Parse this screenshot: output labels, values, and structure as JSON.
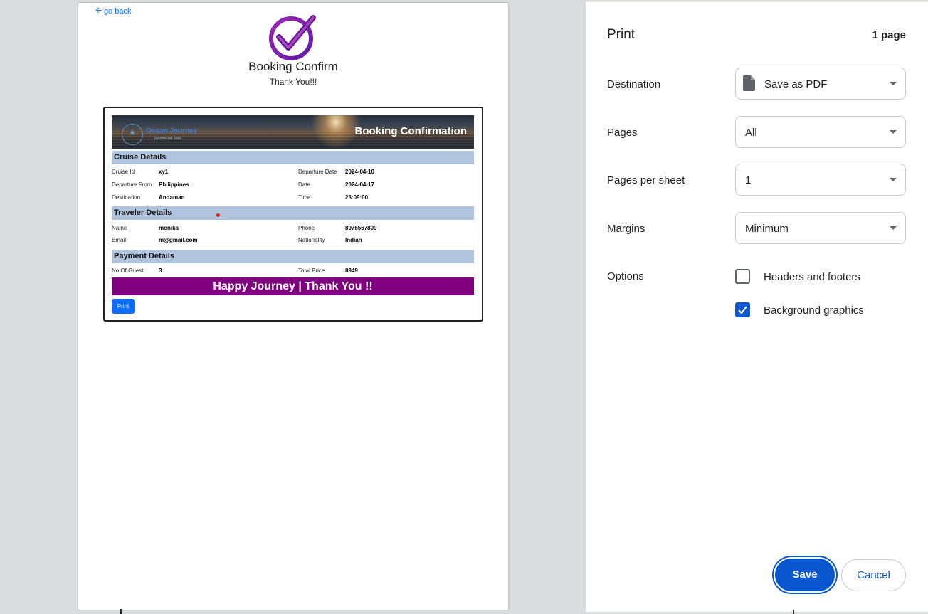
{
  "preview": {
    "go_back": "go back",
    "confirm_title": "Booking Confirm",
    "confirm_subtitle": "Thank You!!!",
    "ticket": {
      "banner_title": "Booking Confirmation",
      "brand_name": "Ocean Journey",
      "brand_tagline": "Explore the Seas",
      "sections": {
        "cruise": "Cruise Details",
        "traveler": "Traveler Details",
        "payment": "Payment Details"
      },
      "cruise_details": [
        {
          "label": "Cruise Id",
          "value": "xy1",
          "label2": "Departure Date",
          "value2": "2024-04-10"
        },
        {
          "label": "Departure From",
          "value": "Philippines",
          "label2": "Date",
          "value2": "2024-04-17"
        },
        {
          "label": "Destination",
          "value": "Andaman",
          "label2": "Time",
          "value2": "23:09:00"
        }
      ],
      "traveler_details": [
        {
          "label": "Name",
          "value": "monika",
          "label2": "Phone",
          "value2": "8976567809"
        },
        {
          "label": "Email",
          "value": "m@gmail.com",
          "label2": "Nationality",
          "value2": "Indian"
        }
      ],
      "payment_details": [
        {
          "label": "No Of Guest",
          "value": "3",
          "label2": "Total Price",
          "value2": "8949"
        }
      ],
      "footer": "Happy Journey | Thank You !!",
      "print_button": "Print"
    },
    "colors": {
      "section_bg": "#b0c4de",
      "footer_bg": "#800080",
      "logo_purple": "#7b1fa2"
    }
  },
  "panel": {
    "title": "Print",
    "page_count": "1 page",
    "destination": {
      "label": "Destination",
      "value": "Save as PDF",
      "icon": "document-icon"
    },
    "pages": {
      "label": "Pages",
      "value": "All"
    },
    "pages_per_sheet": {
      "label": "Pages per sheet",
      "value": "1"
    },
    "margins": {
      "label": "Margins",
      "value": "Minimum"
    },
    "options": {
      "label": "Options",
      "headers_footers": {
        "label": "Headers and footers",
        "checked": false
      },
      "background_graphics": {
        "label": "Background graphics",
        "checked": true
      }
    },
    "save_button": "Save",
    "cancel_button": "Cancel",
    "accent": "#0b57d0"
  }
}
